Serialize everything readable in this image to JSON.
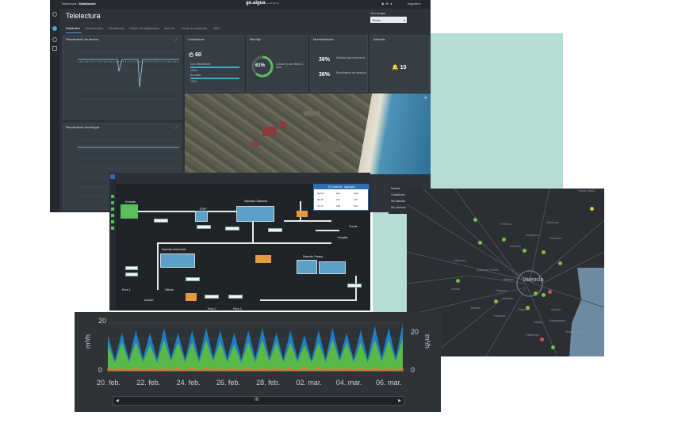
{
  "dashboard": {
    "breadcrumb_prefix": "Telelectura /",
    "breadcrumb_current": "Dashboard",
    "logo": "go.aigua",
    "logo_sub": "powered by",
    "user": "Ingeniero",
    "title": "Telelectura",
    "tecnologia_label": "Tecnología",
    "tecnologia_value": "Todos",
    "tabs": [
      "Dashboard",
      "Monitorización",
      "Rendimiento",
      "Grados de implantación",
      "Alarmas",
      "Trazas de suministro",
      "SMS"
    ],
    "panels": {
      "lectura": {
        "title": "Rendimiento de lectura"
      },
      "tecnologia": {
        "title": "Rendimiento tecnología"
      },
      "contadores": {
        "title": "Contadores",
        "count": "60",
        "row1_label": "Con telemedición",
        "row1_value": "100%",
        "row1_fill": 1.0,
        "row2_label": "Sin tarifa",
        "row2_value": "100%",
        "row2_fill": 1.0
      },
      "red_fija": {
        "title": "Red fija",
        "percent": "61%",
        "percent_value": 61,
        "caption": "Leídos en los últimos 2 días"
      },
      "monitorizacion": {
        "title": "Monitorización",
        "v1": "36%",
        "l1": "Módulos que comunican",
        "v2": "36%",
        "l2": "Rendimiento de módulos"
      },
      "alarmas": {
        "title": "Alarmas",
        "count": "15"
      }
    }
  },
  "scada": {
    "nodes": {
      "embalse": "Embalse",
      "etap": "ETAP",
      "deposito_cabecera": "Depósito Cabecera",
      "deposito_intermedio": "Depósito Intermedio",
      "deposito_parque": "Depósito Parque",
      "hospital": "Hospital",
      "fuente": "Fuente",
      "pozo1": "Pozo 1",
      "pozo2": "Pozo 2",
      "pozo3": "Pozo 3",
      "acuario": "Acuario",
      "oficina": "Oficina"
    },
    "popup": {
      "title": "El Consumo - Agrupado",
      "rows": [
        [
          "Sector",
          "Hoy",
          "Ayer"
        ],
        [
          "30,45",
          "127",
          "115"
        ],
        [
          "31,12",
          "128",
          "133"
        ]
      ]
    }
  },
  "legend": {
    "items": [
      "Normal",
      "Contadores",
      "Sin alarmas",
      "Sin comunic."
    ]
  },
  "map": {
    "city": "Valencia",
    "labels": [
      "Santa Maria",
      "Paterna",
      "Burjassot",
      "Alboraya",
      "Godella",
      "Rocafort",
      "Quart de Poblet",
      "Torrent",
      "Xirivella",
      "Alaquàs",
      "Sedaví",
      "Alfafar",
      "Catarroja",
      "Picanya",
      "Benetússer",
      "Mislata",
      "Manises",
      "Aldaia",
      "Paiporta",
      "Massanassa"
    ]
  },
  "chart_data": {
    "type": "area",
    "x": [
      "20. feb.",
      "22. feb.",
      "24. feb.",
      "26. feb.",
      "28. feb.",
      "02. mar.",
      "04. mar.",
      "06. mar."
    ],
    "ylabel_left": "m³/h",
    "ylabel_right": "m³/h",
    "ylim_left": [
      0,
      20
    ],
    "ylim_right": [
      0,
      20
    ],
    "left_ticks": [
      "20",
      "0"
    ],
    "right_ticks": [
      "20",
      "0"
    ],
    "series": [
      {
        "color": "#1f7fc4",
        "values": [
          15,
          16,
          17,
          16,
          18,
          16,
          17,
          18,
          17,
          16,
          17,
          18,
          16,
          17,
          15,
          17,
          18,
          16,
          17,
          19,
          18,
          20
        ]
      },
      {
        "color": "#58b947",
        "values": [
          11,
          12,
          12,
          11,
          13,
          12,
          12,
          13,
          12,
          11,
          12,
          13,
          12,
          12,
          11,
          12,
          13,
          12,
          12,
          13,
          13,
          14
        ]
      },
      {
        "color": "#ff6b3d",
        "values": [
          1,
          1,
          1,
          1,
          1,
          1,
          1,
          1,
          1,
          1,
          1,
          1,
          1,
          1,
          1,
          1,
          1,
          1,
          1,
          1,
          1,
          1
        ]
      }
    ]
  },
  "scrollbar": {
    "grip": "III"
  }
}
